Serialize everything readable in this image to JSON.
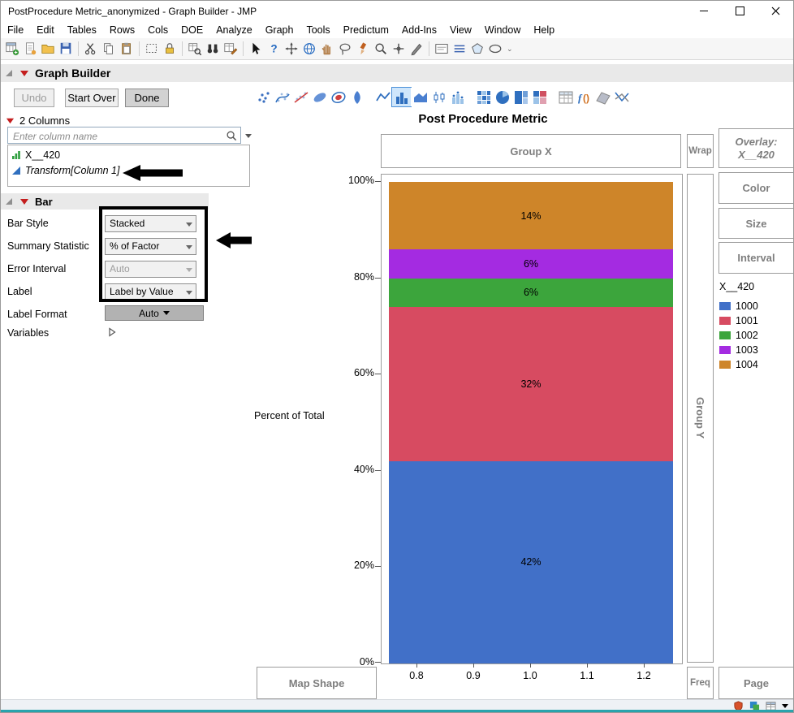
{
  "titlebar": {
    "title": "PostProcedure Metric_anonymized - Graph Builder - JMP"
  },
  "menubar": {
    "items": [
      "File",
      "Edit",
      "Tables",
      "Rows",
      "Cols",
      "DOE",
      "Analyze",
      "Graph",
      "Tools",
      "Predictum",
      "Add-Ins",
      "View",
      "Window",
      "Help"
    ]
  },
  "toolbar": {
    "icons": [
      "new-data-table",
      "new-journal",
      "open-file",
      "save-file",
      "cut",
      "copy",
      "paste",
      "select-rectangle",
      "lock",
      "table-find",
      "binoculars",
      "table-edit",
      "cursor-arrow",
      "help",
      "move-tool",
      "globe-tool",
      "hand-tool",
      "lasso-tool",
      "brush-tool",
      "magnifier-tool",
      "crosshair-tool",
      "pen-tool",
      "caption-box",
      "line-tool",
      "polygon-tool",
      "oval-tool",
      "overflow-chevron"
    ]
  },
  "graph_builder": {
    "title": "Graph Builder",
    "undo_label": "Undo",
    "start_over_label": "Start Over",
    "done_label": "Done",
    "palette": {
      "selected": "bar",
      "icons": [
        "points",
        "smoother",
        "line-of-fit",
        "ellipse",
        "contour",
        "violin",
        "line",
        "bar",
        "area",
        "box-plot",
        "bar-points",
        "heatmap",
        "pie",
        "treemap",
        "mosaic",
        "tabulate",
        "formula",
        "surface",
        "parallel"
      ]
    }
  },
  "columns_panel": {
    "header": "2 Columns",
    "search_placeholder": "Enter column name",
    "items": [
      {
        "name": "X__420",
        "icon": "continuous-column-icon"
      },
      {
        "name": "Transform[Column 1]",
        "icon": "transform-column-icon"
      }
    ]
  },
  "bar_panel": {
    "header": "Bar",
    "bar_style_label": "Bar Style",
    "bar_style_value": "Stacked",
    "summary_label": "Summary Statistic",
    "summary_value": "% of Factor",
    "error_label": "Error Interval",
    "error_value": "Auto",
    "label_label": "Label",
    "label_value": "Label by Value",
    "label_format_label": "Label Format",
    "label_format_value": "Auto",
    "variables_label": "Variables"
  },
  "chart": {
    "title": "Post Procedure Metric",
    "zones": {
      "group_x": "Group X",
      "wrap": "Wrap",
      "overlay_title": "Overlay:",
      "overlay_value": "X__420",
      "color": "Color",
      "size": "Size",
      "interval": "Interval",
      "group_y": "Group Y",
      "map_shape": "Map Shape",
      "freq": "Freq",
      "page": "Page"
    },
    "y_axis": {
      "label": "Percent of Total",
      "ticks": [
        "100%",
        "80%",
        "60%",
        "40%",
        "20%",
        "0%"
      ]
    },
    "x_axis": {
      "ticks": [
        "0.8",
        "0.9",
        "1.0",
        "1.1",
        "1.2"
      ]
    },
    "legend": {
      "title": "X__420",
      "entries": [
        {
          "label": "1000",
          "color": "#4170C8"
        },
        {
          "label": "1001",
          "color": "#D74B61"
        },
        {
          "label": "1002",
          "color": "#3CA53C"
        },
        {
          "label": "1003",
          "color": "#A42BE1"
        },
        {
          "label": "1004",
          "color": "#CE8529"
        }
      ]
    },
    "segments": [
      {
        "label": "42%",
        "value": 42,
        "color": "#4170C8"
      },
      {
        "label": "32%",
        "value": 32,
        "color": "#D74B61"
      },
      {
        "label": "6%",
        "value": 6,
        "color": "#3CA53C"
      },
      {
        "label": "6%",
        "value": 6,
        "color": "#A42BE1"
      },
      {
        "label": "14%",
        "value": 14,
        "color": "#CE8529"
      }
    ]
  },
  "chart_data": {
    "type": "bar",
    "stacked": true,
    "title": "Post Procedure Metric",
    "xlabel": "Group X",
    "ylabel": "Percent of Total",
    "x": [
      1.0
    ],
    "x_axis_ticks": [
      0.8,
      0.9,
      1.0,
      1.1,
      1.2
    ],
    "ylim_percent": [
      0,
      100
    ],
    "summary_statistic": "% of Factor",
    "series": [
      {
        "name": "1000",
        "color": "#4170C8",
        "values_percent": [
          42
        ]
      },
      {
        "name": "1001",
        "color": "#D74B61",
        "values_percent": [
          32
        ]
      },
      {
        "name": "1002",
        "color": "#3CA53C",
        "values_percent": [
          6
        ]
      },
      {
        "name": "1003",
        "color": "#A42BE1",
        "values_percent": [
          6
        ]
      },
      {
        "name": "1004",
        "color": "#CE8529",
        "values_percent": [
          14
        ]
      }
    ],
    "legend_title": "X__420",
    "legend_position": "right"
  },
  "statusbar": {
    "icons": [
      "security-shield-icon",
      "layers-status-icon",
      "grid-status-icon",
      "status-dropdown-caret"
    ]
  }
}
